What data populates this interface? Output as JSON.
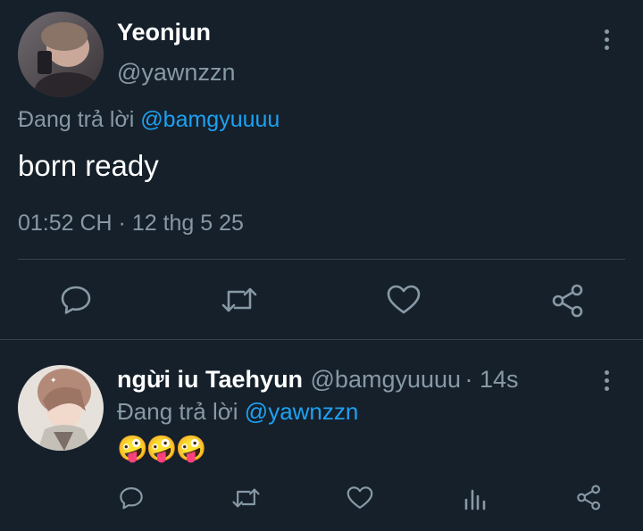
{
  "main_tweet": {
    "author_name": "Yeonjun",
    "author_handle": "@yawnzzn",
    "reply_prefix": "Đang trả lời",
    "reply_to": "@bamgyuuuu",
    "text": "born ready",
    "timestamp": "01:52 CH · 12 thg 5 25",
    "actions": [
      "reply-icon",
      "retweet-icon",
      "like-icon",
      "share-icon"
    ]
  },
  "reply_tweet": {
    "author_name": "ngừi iu Taehyun",
    "author_handle": "@bamgyuuuu",
    "time_ago": "· 14s",
    "reply_prefix": "Đang trả lời",
    "reply_to": "@yawnzzn",
    "text": "🤪🤪🤪",
    "actions": [
      "reply-icon",
      "retweet-icon",
      "like-icon",
      "analytics-icon",
      "share-icon"
    ]
  },
  "colors": {
    "background": "#15202b",
    "text": "#ffffff",
    "secondary": "#8899a6",
    "accent": "#1da1f2",
    "divider": "#38444d"
  }
}
